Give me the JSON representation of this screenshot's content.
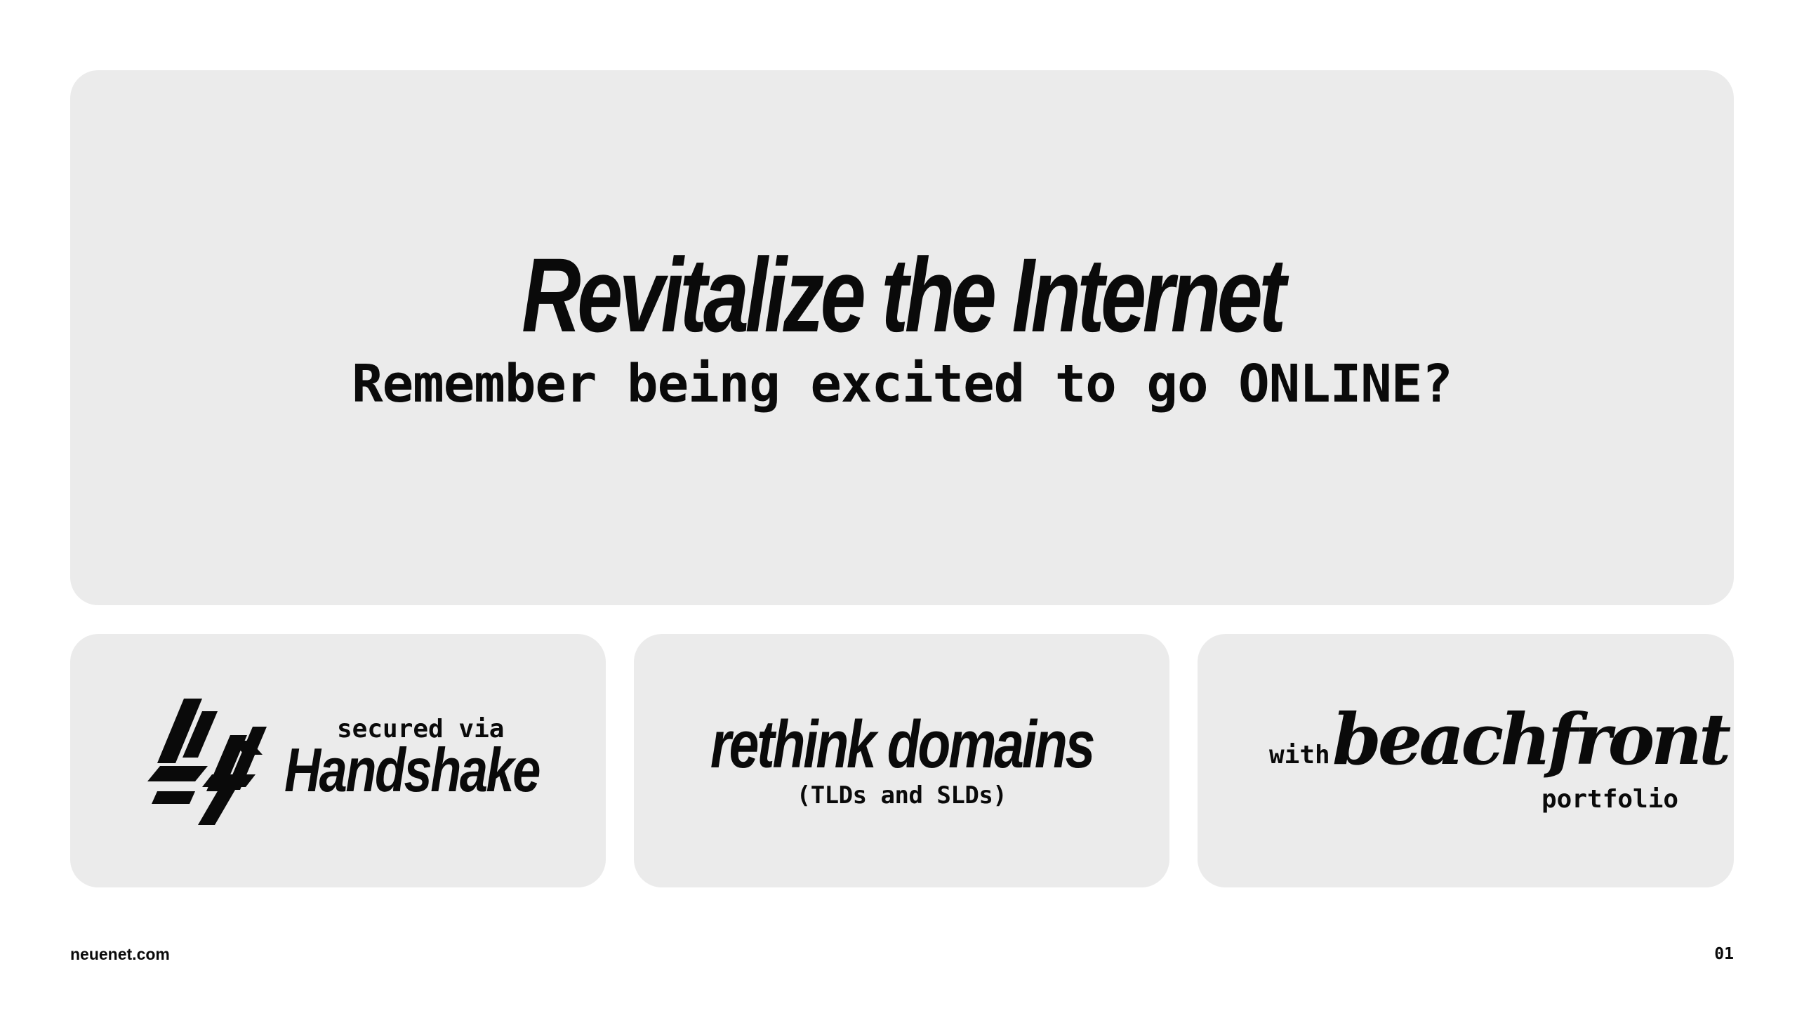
{
  "hero": {
    "title": "Revitalize the Internet",
    "subtitle": "Remember being excited to go ONLINE?"
  },
  "handshake_card": {
    "logo_icon": "handshake-logo-icon",
    "secured_label": "secured via",
    "name": "Handshake"
  },
  "domains_card": {
    "title": "rethink domains",
    "subtitle": "(TLDs and SLDs)"
  },
  "beachfront_card": {
    "with_label": "with",
    "name": "beachfront",
    "portfolio_label": "portfolio"
  },
  "footer": {
    "site": "neuenet.com",
    "page_number": "01"
  }
}
